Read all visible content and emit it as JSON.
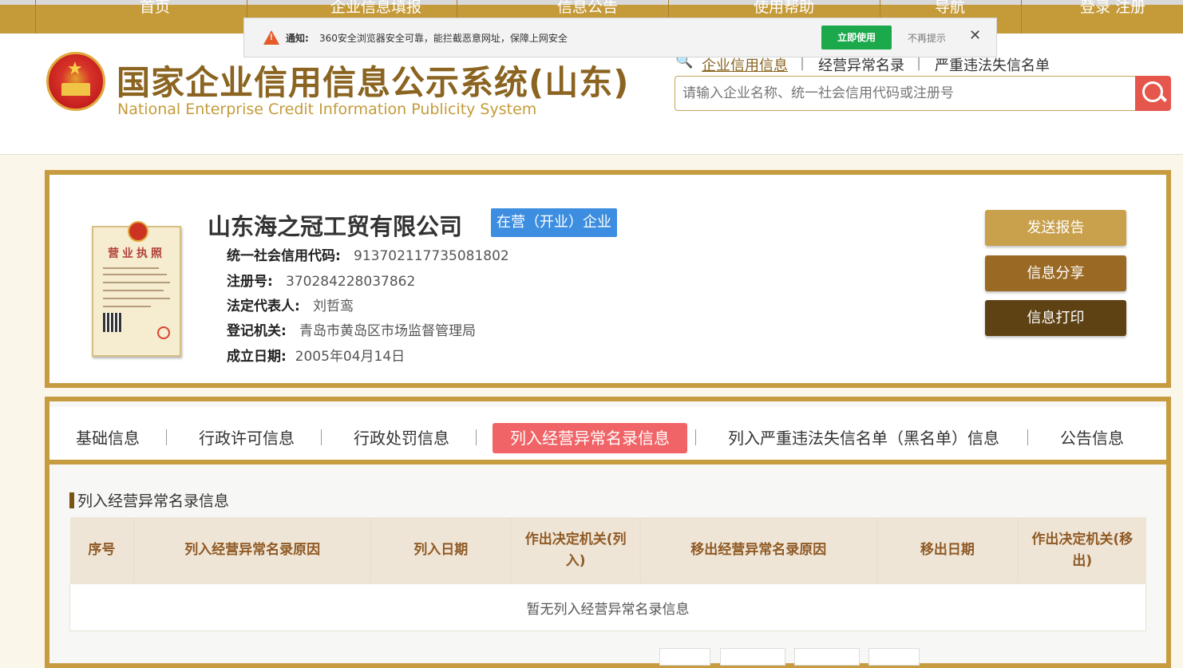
{
  "topnav": {
    "items": [
      "首页",
      "企业信息填报",
      "信息公告",
      "使用帮助",
      "导航",
      "登录  注册"
    ]
  },
  "notice": {
    "label": "通知:",
    "text": "360安全浏览器安全可靠，能拦截恶意网址，保障上网安全",
    "use_button": "立即使用",
    "no_more": "不再提示",
    "close": "✕"
  },
  "header": {
    "title": "国家企业信用信息公示系统(山东)",
    "subtitle": "National Enterprise Credit Information Publicity System",
    "search_tabs": [
      "企业信用信息",
      "经营异常名录",
      "严重违法失信名单"
    ],
    "search_placeholder": "请输入企业名称、统一社会信用代码或注册号"
  },
  "company": {
    "license_title": "营业执照",
    "name": "山东海之冠工贸有限公司",
    "status": "在营（开业）企业",
    "fields": [
      {
        "key": "统一社会信用代码:",
        "value": "913702117735081802"
      },
      {
        "key": "注册号:",
        "value": "370284228037862"
      },
      {
        "key": "法定代表人:",
        "value": "刘哲鸾"
      },
      {
        "key": "登记机关:",
        "value": "青岛市黄岛区市场监督管理局"
      },
      {
        "key": "成立日期:",
        "value": "2005年04月14日"
      }
    ],
    "actions": [
      "发送报告",
      "信息分享",
      "信息打印"
    ]
  },
  "tabs": {
    "items": [
      "基础信息",
      "行政许可信息",
      "行政处罚信息",
      "列入经营异常名录信息",
      "列入严重违法失信名单（黑名单）信息",
      "公告信息"
    ],
    "active_index": 3
  },
  "section": {
    "title": "列入经营异常名录信息",
    "columns": [
      "序号",
      "列入经营异常名录原因",
      "列入日期",
      "作出决定机关(列入)",
      "移出经营异常名录原因",
      "移出日期",
      "作出决定机关(移出)"
    ],
    "empty_text": "暂无列入经营异常名录信息"
  },
  "colors": {
    "gold": "#c79b40",
    "btn_report": "#c9a04c",
    "btn_share": "#9a6a24",
    "btn_print": "#5e4214",
    "active_tab": "#f06467",
    "status_badge": "#3d8ee0"
  }
}
